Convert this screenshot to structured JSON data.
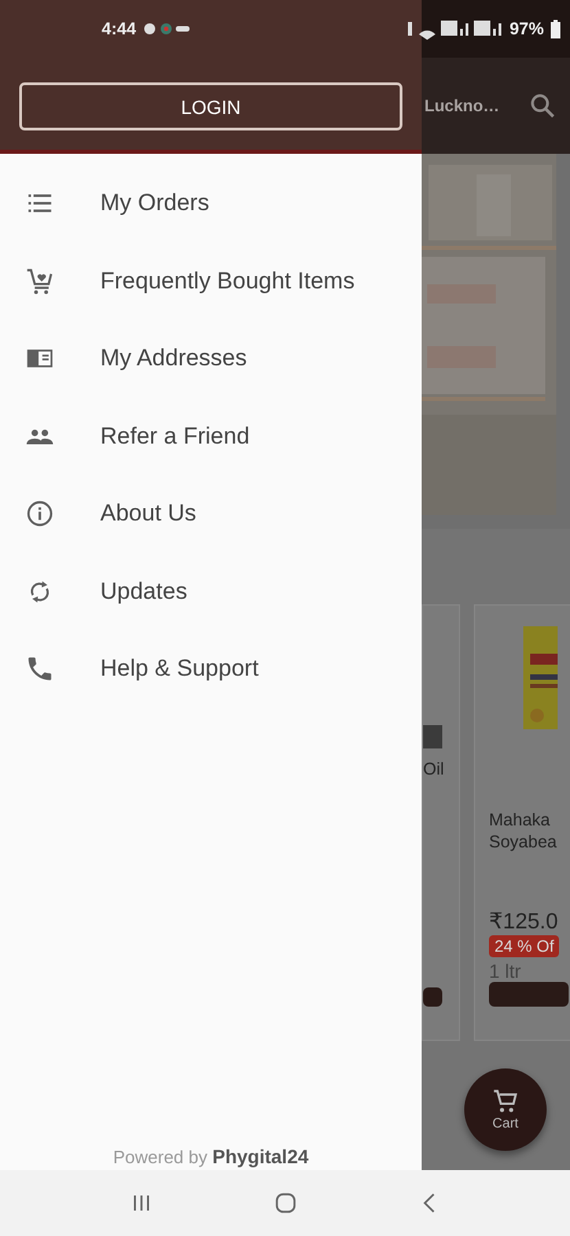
{
  "status_bar": {
    "time": "4:44",
    "battery": "97%"
  },
  "drawer": {
    "login_button": "LOGIN",
    "items": [
      {
        "label": "My Orders"
      },
      {
        "label": "Frequently Bought Items"
      },
      {
        "label": "My Addresses"
      },
      {
        "label": "Refer a Friend"
      },
      {
        "label": "About Us"
      },
      {
        "label": "Updates"
      },
      {
        "label": "Help & Support"
      }
    ],
    "footer": "Powered by **Phygital24**"
  },
  "background": {
    "location": "Luckno…",
    "products": [
      {
        "name_lines": [
          "Oil"
        ]
      },
      {
        "name_lines": [
          "Mahaka",
          "Soyabea"
        ],
        "price": "₹125.0",
        "discount": "24 % Of",
        "unit": "1 ltr"
      }
    ],
    "cart_label": "Cart"
  }
}
